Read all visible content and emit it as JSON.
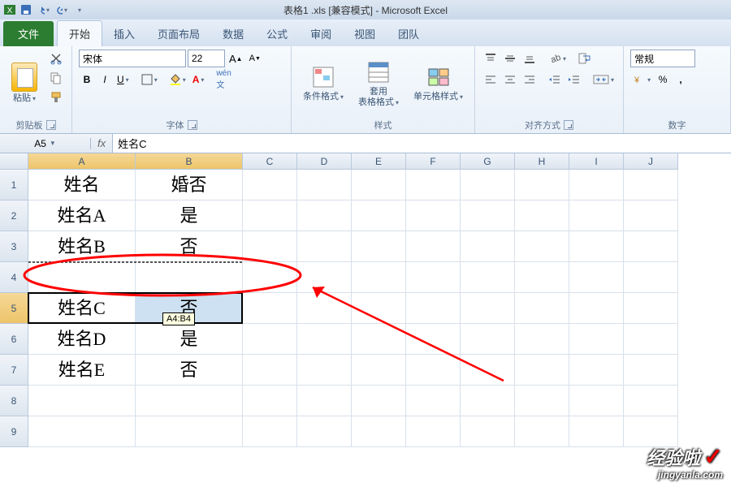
{
  "title": "表格1 .xls  [兼容模式] - Microsoft Excel",
  "tabs": {
    "file": "文件",
    "home": "开始",
    "insert": "插入",
    "layout": "页面布局",
    "data": "数据",
    "formulas": "公式",
    "review": "审阅",
    "view": "视图",
    "team": "团队"
  },
  "ribbon": {
    "clipboard": {
      "paste": "粘贴",
      "label": "剪贴板"
    },
    "font": {
      "name": "宋体",
      "size": "22",
      "label": "字体"
    },
    "styles": {
      "cond": "条件格式",
      "table": "套用\n表格格式",
      "cell": "单元格样式",
      "label": "样式"
    },
    "align": {
      "label": "对齐方式"
    },
    "number": {
      "general": "常规",
      "label": "数字"
    }
  },
  "namebox": "A5",
  "formula": "姓名C",
  "cols": [
    "A",
    "B",
    "C",
    "D",
    "E",
    "F",
    "G",
    "H",
    "I",
    "J"
  ],
  "rows": [
    "1",
    "2",
    "3",
    "4",
    "5",
    "6",
    "7",
    "8",
    "9"
  ],
  "data": {
    "A1": "姓名",
    "B1": "婚否",
    "A2": "姓名A",
    "B2": "是",
    "A3": "姓名B",
    "B3": "否",
    "A5": "姓名C",
    "B5": "否",
    "A6": "姓名D",
    "B6": "是",
    "A7": "姓名E",
    "B7": "否"
  },
  "tooltip": "A4:B4",
  "watermark": {
    "l1": "经验啦",
    "l2": "jingyanla.com"
  }
}
